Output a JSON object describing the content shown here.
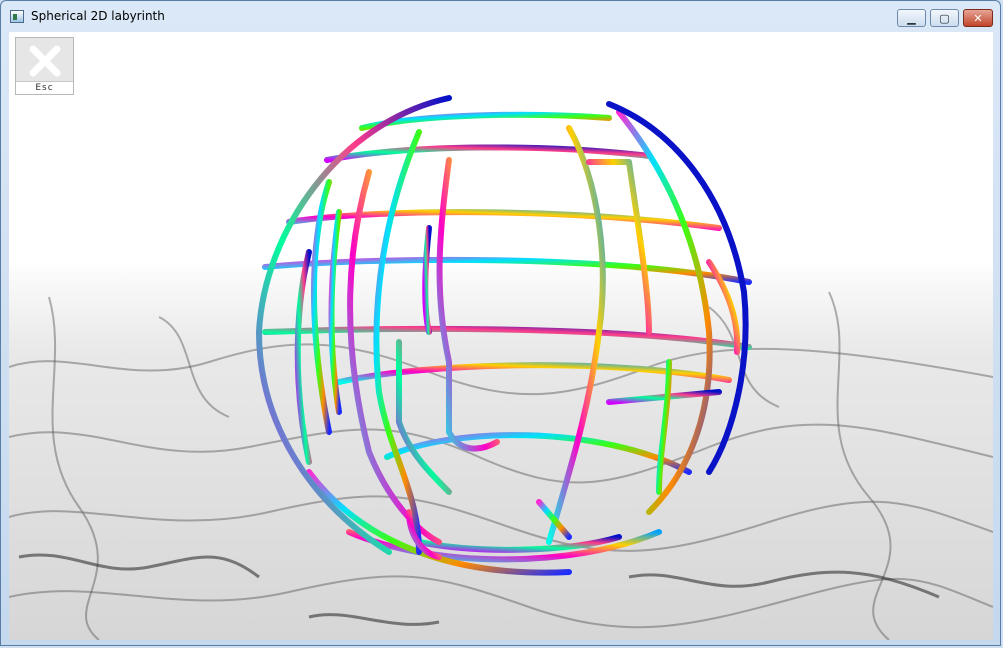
{
  "window": {
    "title": "Spherical 2D labyrinth",
    "controls": {
      "minimize": "▁",
      "maximize": "▢",
      "close": "✕"
    }
  },
  "overlay": {
    "esc_label": "Esc"
  },
  "colors": {
    "titlebar": "#c4d8ee",
    "close_button": "#c1452b",
    "floor_marble": "#d8d8d8",
    "sky": "#ffffff"
  },
  "icons": [
    "app-icon",
    "minimize-icon",
    "maximize-icon",
    "close-icon",
    "esc-close-icon"
  ]
}
